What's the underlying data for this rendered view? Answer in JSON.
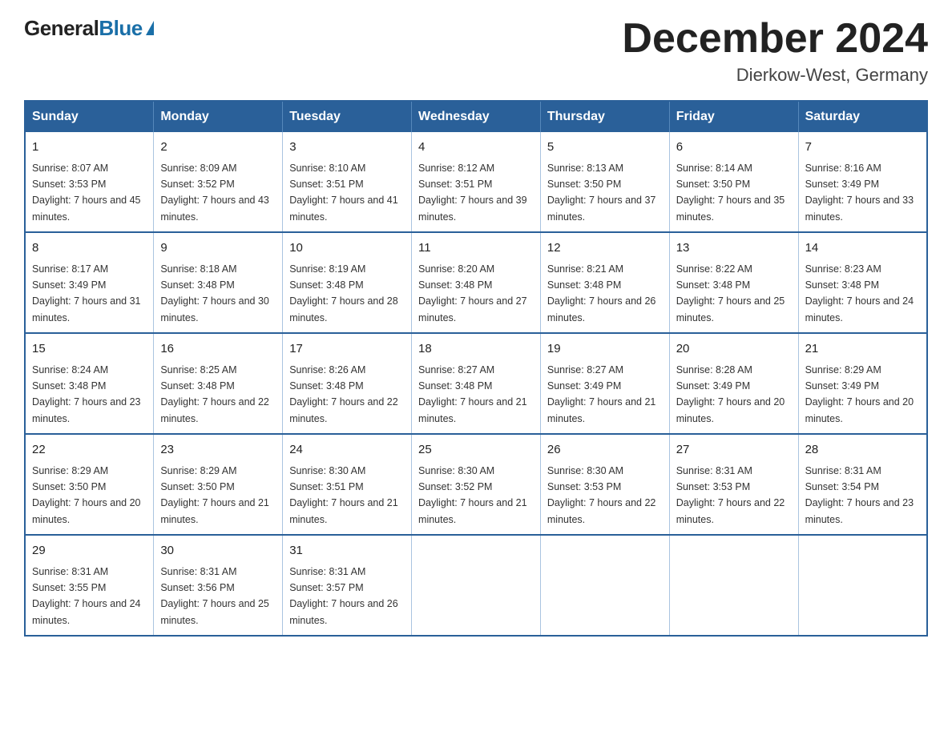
{
  "header": {
    "logo": {
      "general": "General",
      "blue": "Blue"
    },
    "title": "December 2024",
    "location": "Dierkow-West, Germany"
  },
  "calendar": {
    "days_of_week": [
      "Sunday",
      "Monday",
      "Tuesday",
      "Wednesday",
      "Thursday",
      "Friday",
      "Saturday"
    ],
    "weeks": [
      [
        {
          "day": "1",
          "sunrise": "8:07 AM",
          "sunset": "3:53 PM",
          "daylight": "7 hours and 45 minutes."
        },
        {
          "day": "2",
          "sunrise": "8:09 AM",
          "sunset": "3:52 PM",
          "daylight": "7 hours and 43 minutes."
        },
        {
          "day": "3",
          "sunrise": "8:10 AM",
          "sunset": "3:51 PM",
          "daylight": "7 hours and 41 minutes."
        },
        {
          "day": "4",
          "sunrise": "8:12 AM",
          "sunset": "3:51 PM",
          "daylight": "7 hours and 39 minutes."
        },
        {
          "day": "5",
          "sunrise": "8:13 AM",
          "sunset": "3:50 PM",
          "daylight": "7 hours and 37 minutes."
        },
        {
          "day": "6",
          "sunrise": "8:14 AM",
          "sunset": "3:50 PM",
          "daylight": "7 hours and 35 minutes."
        },
        {
          "day": "7",
          "sunrise": "8:16 AM",
          "sunset": "3:49 PM",
          "daylight": "7 hours and 33 minutes."
        }
      ],
      [
        {
          "day": "8",
          "sunrise": "8:17 AM",
          "sunset": "3:49 PM",
          "daylight": "7 hours and 31 minutes."
        },
        {
          "day": "9",
          "sunrise": "8:18 AM",
          "sunset": "3:48 PM",
          "daylight": "7 hours and 30 minutes."
        },
        {
          "day": "10",
          "sunrise": "8:19 AM",
          "sunset": "3:48 PM",
          "daylight": "7 hours and 28 minutes."
        },
        {
          "day": "11",
          "sunrise": "8:20 AM",
          "sunset": "3:48 PM",
          "daylight": "7 hours and 27 minutes."
        },
        {
          "day": "12",
          "sunrise": "8:21 AM",
          "sunset": "3:48 PM",
          "daylight": "7 hours and 26 minutes."
        },
        {
          "day": "13",
          "sunrise": "8:22 AM",
          "sunset": "3:48 PM",
          "daylight": "7 hours and 25 minutes."
        },
        {
          "day": "14",
          "sunrise": "8:23 AM",
          "sunset": "3:48 PM",
          "daylight": "7 hours and 24 minutes."
        }
      ],
      [
        {
          "day": "15",
          "sunrise": "8:24 AM",
          "sunset": "3:48 PM",
          "daylight": "7 hours and 23 minutes."
        },
        {
          "day": "16",
          "sunrise": "8:25 AM",
          "sunset": "3:48 PM",
          "daylight": "7 hours and 22 minutes."
        },
        {
          "day": "17",
          "sunrise": "8:26 AM",
          "sunset": "3:48 PM",
          "daylight": "7 hours and 22 minutes."
        },
        {
          "day": "18",
          "sunrise": "8:27 AM",
          "sunset": "3:48 PM",
          "daylight": "7 hours and 21 minutes."
        },
        {
          "day": "19",
          "sunrise": "8:27 AM",
          "sunset": "3:49 PM",
          "daylight": "7 hours and 21 minutes."
        },
        {
          "day": "20",
          "sunrise": "8:28 AM",
          "sunset": "3:49 PM",
          "daylight": "7 hours and 20 minutes."
        },
        {
          "day": "21",
          "sunrise": "8:29 AM",
          "sunset": "3:49 PM",
          "daylight": "7 hours and 20 minutes."
        }
      ],
      [
        {
          "day": "22",
          "sunrise": "8:29 AM",
          "sunset": "3:50 PM",
          "daylight": "7 hours and 20 minutes."
        },
        {
          "day": "23",
          "sunrise": "8:29 AM",
          "sunset": "3:50 PM",
          "daylight": "7 hours and 21 minutes."
        },
        {
          "day": "24",
          "sunrise": "8:30 AM",
          "sunset": "3:51 PM",
          "daylight": "7 hours and 21 minutes."
        },
        {
          "day": "25",
          "sunrise": "8:30 AM",
          "sunset": "3:52 PM",
          "daylight": "7 hours and 21 minutes."
        },
        {
          "day": "26",
          "sunrise": "8:30 AM",
          "sunset": "3:53 PM",
          "daylight": "7 hours and 22 minutes."
        },
        {
          "day": "27",
          "sunrise": "8:31 AM",
          "sunset": "3:53 PM",
          "daylight": "7 hours and 22 minutes."
        },
        {
          "day": "28",
          "sunrise": "8:31 AM",
          "sunset": "3:54 PM",
          "daylight": "7 hours and 23 minutes."
        }
      ],
      [
        {
          "day": "29",
          "sunrise": "8:31 AM",
          "sunset": "3:55 PM",
          "daylight": "7 hours and 24 minutes."
        },
        {
          "day": "30",
          "sunrise": "8:31 AM",
          "sunset": "3:56 PM",
          "daylight": "7 hours and 25 minutes."
        },
        {
          "day": "31",
          "sunrise": "8:31 AM",
          "sunset": "3:57 PM",
          "daylight": "7 hours and 26 minutes."
        },
        null,
        null,
        null,
        null
      ]
    ]
  }
}
